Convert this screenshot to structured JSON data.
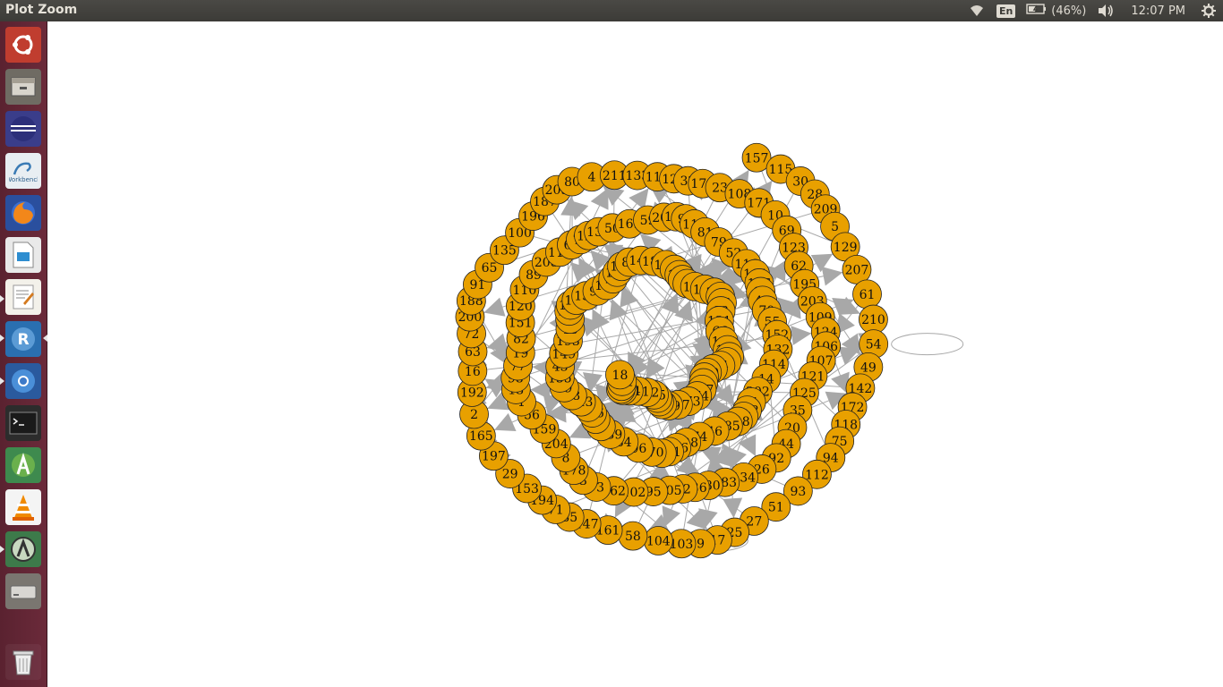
{
  "window": {
    "title": "Plot Zoom"
  },
  "topbar": {
    "keyboard_layout": "En",
    "battery_text": "(46%)",
    "clock": "12:07 PM"
  },
  "launcher": {
    "items": [
      {
        "name": "ubuntu-dash-icon"
      },
      {
        "name": "files-icon"
      },
      {
        "name": "eclipse-icon"
      },
      {
        "name": "mysql-workbench-icon",
        "label": "Workbench"
      },
      {
        "name": "firefox-icon"
      },
      {
        "name": "libreoffice-impress-icon"
      },
      {
        "name": "text-editor-icon"
      },
      {
        "name": "rstudio-icon",
        "label": "R"
      },
      {
        "name": "chromium-icon"
      },
      {
        "name": "terminal-icon"
      },
      {
        "name": "android-studio-icon"
      },
      {
        "name": "vlc-icon"
      },
      {
        "name": "software-updater-icon"
      },
      {
        "name": "drive-icon"
      },
      {
        "name": "trash-icon"
      }
    ]
  },
  "plot": {
    "node_fill": "#e8a000",
    "node_stroke": "#222222",
    "edge_color": "#a8a8a8",
    "nodes": [
      "157",
      "115",
      "30",
      "28",
      "209",
      "5",
      "129",
      "207",
      "61",
      "210",
      "54",
      "49",
      "142",
      "172",
      "118",
      "75",
      "94",
      "112",
      "93",
      "51",
      "27",
      "25",
      "17",
      "9",
      "103",
      "104",
      "58",
      "161",
      "147",
      "85",
      "71",
      "194",
      "153",
      "29",
      "197",
      "165",
      "2",
      "192",
      "16",
      "63",
      "72",
      "200",
      "188",
      "91",
      "65",
      "135",
      "100",
      "196",
      "187",
      "205",
      "80",
      "4",
      "211",
      "133",
      "111",
      "126",
      "32",
      "176",
      "23",
      "108",
      "171",
      "10",
      "69",
      "123",
      "62",
      "195",
      "203",
      "109",
      "124",
      "106",
      "107",
      "121",
      "125",
      "35",
      "20",
      "44",
      "92",
      "26",
      "134",
      "183",
      "180",
      "136",
      "12",
      "105",
      "95",
      "102",
      "162",
      "73",
      "3",
      "178",
      "8",
      "204",
      "159",
      "56",
      "1",
      "13",
      "98",
      "77",
      "19",
      "82",
      "151",
      "120",
      "110",
      "89",
      "208",
      "113",
      "64",
      "76",
      "127",
      "138",
      "50",
      "169",
      "59",
      "206",
      "198",
      "90",
      "117",
      "81",
      "79",
      "52",
      "116",
      "164",
      "166",
      "11",
      "45",
      "70",
      "55",
      "152",
      "132",
      "114",
      "14",
      "202",
      "41",
      "182",
      "33",
      "148",
      "185",
      "46",
      "74",
      "128",
      "156",
      "101",
      "7",
      "170",
      "96",
      "34",
      "139",
      "47",
      "48",
      "146",
      "57",
      "143",
      "78",
      "99",
      "155",
      "43",
      "149",
      "193",
      "15",
      "67",
      "179",
      "199",
      "168",
      "150",
      "97",
      "181",
      "24",
      "144",
      "140",
      "86",
      "145",
      "184",
      "141",
      "60",
      "158",
      "42",
      "6",
      "160",
      "190",
      "22",
      "87",
      "37",
      "83",
      "131",
      "66",
      "186",
      "119",
      "38",
      "53",
      "84",
      "39",
      "130",
      "21",
      "31",
      "167",
      "174",
      "173",
      "137",
      "189",
      "36",
      "40",
      "88",
      "175",
      "122",
      "201",
      "154",
      "163",
      "68",
      "177",
      "191",
      "18"
    ]
  }
}
